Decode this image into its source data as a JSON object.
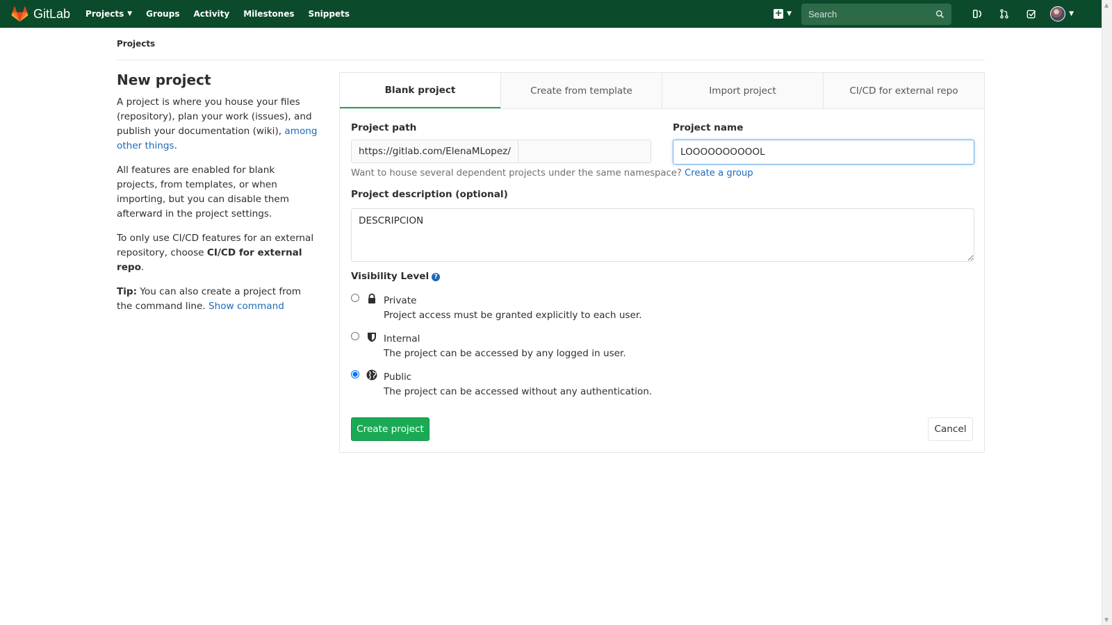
{
  "navbar": {
    "brand": "GitLab",
    "links": [
      {
        "label": "Projects",
        "dropdown": true
      },
      {
        "label": "Groups"
      },
      {
        "label": "Activity"
      },
      {
        "label": "Milestones"
      },
      {
        "label": "Snippets"
      }
    ],
    "search_placeholder": "Search",
    "icons": [
      "plus-square-icon",
      "search-icon",
      "issues-icon",
      "merge-request-icon",
      "todos-icon",
      "avatar"
    ]
  },
  "breadcrumb": "Projects",
  "sidebar": {
    "title": "New project",
    "p1_text": "A project is where you house your files (repository), plan your work (issues), and publish your documentation (wiki), ",
    "p1_link": "among other things",
    "p1_end": ".",
    "p2": "All features are enabled for blank projects, from templates, or when importing, but you can disable them afterward in the project settings.",
    "p3_text": "To only use CI/CD features for an external repository, choose ",
    "p3_bold": "CI/CD for external repo",
    "p3_end": ".",
    "tip_label": "Tip:",
    "tip_text": " You can also create a project from the command line. ",
    "tip_link": "Show command"
  },
  "tabs": [
    {
      "label": "Blank project",
      "active": true
    },
    {
      "label": "Create from template"
    },
    {
      "label": "Import project"
    },
    {
      "label": "CI/CD for external repo"
    }
  ],
  "form": {
    "path_label": "Project path",
    "path_prefix": "https://gitlab.com/ElenaMLopez/",
    "name_label": "Project name",
    "name_value": "LOOOOOOOOOOL",
    "hint_text": "Want to house several dependent projects under the same namespace? ",
    "hint_link": "Create a group",
    "desc_label": "Project description (optional)",
    "desc_value": "DESCRIPCION",
    "visibility_label": "Visibility Level",
    "visibility": [
      {
        "name": "Private",
        "desc": "Project access must be granted explicitly to each user.",
        "icon": "lock-icon",
        "checked": false
      },
      {
        "name": "Internal",
        "desc": "The project can be accessed by any logged in user.",
        "icon": "shield-icon",
        "checked": false
      },
      {
        "name": "Public",
        "desc": "The project can be accessed without any authentication.",
        "icon": "globe-icon",
        "checked": true
      }
    ],
    "create_label": "Create project",
    "cancel_label": "Cancel"
  },
  "colors": {
    "navbar": "#0b4b2b",
    "primary": "#1aaa55",
    "link": "#1b69b6"
  }
}
